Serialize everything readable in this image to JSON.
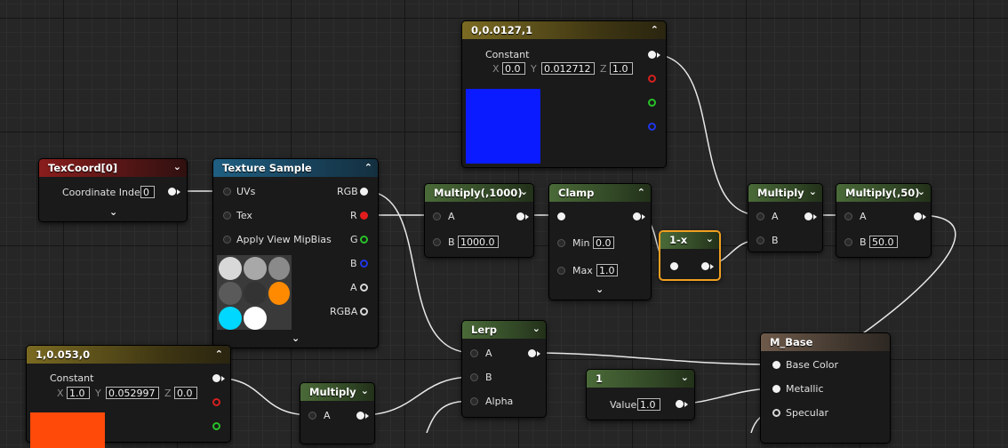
{
  "nodes": {
    "const_top": {
      "title": "0,0.0127,1",
      "label": "Constant",
      "x": "0.0",
      "y": "0.012712",
      "z": "1.0",
      "color": "#0a1bff"
    },
    "texcoord": {
      "title": "TexCoord[0]",
      "coord_label": "Coordinate Index",
      "coord_value": "0"
    },
    "texsample": {
      "title": "Texture Sample",
      "uvs": "UVs",
      "tex": "Tex",
      "mip": "Apply View MipBias",
      "rgb": "RGB",
      "r": "R",
      "g": "G",
      "b": "B",
      "a": "A",
      "rgba": "RGBA"
    },
    "mult1000": {
      "title": "Multiply(,1000)",
      "a": "A",
      "b": "B",
      "b_value": "1000.0"
    },
    "clamp": {
      "title": "Clamp",
      "min": "Min",
      "min_value": "0.0",
      "max": "Max",
      "max_value": "1.0"
    },
    "oneminus": {
      "title": "1-x"
    },
    "multiply": {
      "title": "Multiply",
      "a": "A",
      "b": "B"
    },
    "mult50": {
      "title": "Multiply(,50)",
      "a": "A",
      "b": "B",
      "b_value": "50.0"
    },
    "lerp": {
      "title": "Lerp",
      "a": "A",
      "b": "B",
      "alpha": "Alpha"
    },
    "mbase": {
      "title": "M_Base",
      "base_color": "Base Color",
      "metallic": "Metallic",
      "specular": "Specular"
    },
    "const_one": {
      "title": "1",
      "value_label": "Value",
      "value": "1.0"
    },
    "const_bottom": {
      "title": "1,0.053,0",
      "label": "Constant",
      "x": "1.0",
      "y": "0.052997",
      "z": "0.0",
      "color": "#ff4a0a"
    },
    "mult_bottom": {
      "title": "Multiply",
      "a": "A"
    }
  },
  "axis": {
    "x": "X",
    "y": "Y",
    "z": "Z"
  },
  "icons": {
    "collapse": "chevron-up-icon",
    "expand": "chevron-down-icon"
  },
  "colors": {
    "selection": "#f0a020",
    "wire": "#e8e8e8",
    "pin_red": "#e21c1c",
    "pin_green": "#28c028",
    "pin_blue": "#2036e6"
  }
}
